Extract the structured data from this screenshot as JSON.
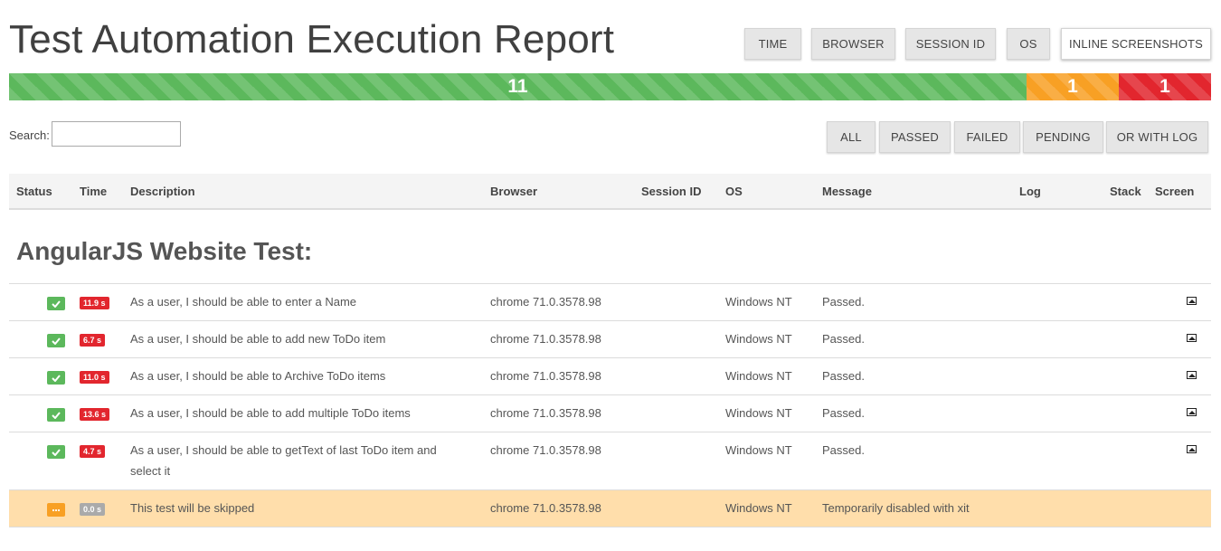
{
  "header": {
    "title": "Test Automation Execution Report",
    "toggles": [
      {
        "label": "TIME"
      },
      {
        "label": "BROWSER"
      },
      {
        "label": "SESSION ID"
      },
      {
        "label": "OS"
      },
      {
        "label": "INLINE SCREENSHOTS"
      }
    ]
  },
  "summary": {
    "passed": "11",
    "pending": "1",
    "failed": "1",
    "colors": {
      "passed": "#5cb85c",
      "pending": "#f8a024",
      "failed": "#e2262e"
    }
  },
  "search": {
    "label": "Search:",
    "value": "",
    "placeholder": ""
  },
  "filters": [
    {
      "label": "ALL"
    },
    {
      "label": "PASSED"
    },
    {
      "label": "FAILED"
    },
    {
      "label": "PENDING"
    },
    {
      "label": "OR WITH LOG"
    }
  ],
  "table": {
    "columns": [
      "Status",
      "Time",
      "Description",
      "Browser",
      "Session ID",
      "OS",
      "Message",
      "Log",
      "Stack",
      "Screen"
    ],
    "suite": "AngularJS Website Test:",
    "rows": [
      {
        "status": "passed",
        "time": "11.9 s",
        "description": "As a user, I should be able to enter a Name",
        "browser": "chrome 71.0.3578.98",
        "session": "",
        "os": "Windows NT",
        "message": "Passed.",
        "screen_icon": "image-icon"
      },
      {
        "status": "passed",
        "time": "6.7 s",
        "description": "As a user, I should be able to add new ToDo item",
        "browser": "chrome 71.0.3578.98",
        "session": "",
        "os": "Windows NT",
        "message": "Passed.",
        "screen_icon": "image-icon"
      },
      {
        "status": "passed",
        "time": "11.0 s",
        "description": "As a user, I should be able to Archive ToDo items",
        "browser": "chrome 71.0.3578.98",
        "session": "",
        "os": "Windows NT",
        "message": "Passed.",
        "screen_icon": "image-icon"
      },
      {
        "status": "passed",
        "time": "13.6 s",
        "description": "As a user, I should be able to add multiple ToDo items",
        "browser": "chrome 71.0.3578.98",
        "session": "",
        "os": "Windows NT",
        "message": "Passed.",
        "screen_icon": "image-icon"
      },
      {
        "status": "passed",
        "time": "4.7 s",
        "description": "As a user, I should be able to getText of last ToDo item and select it",
        "browser": "chrome 71.0.3578.98",
        "session": "",
        "os": "Windows NT",
        "message": "Passed.",
        "screen_icon": "image-icon"
      },
      {
        "status": "pending",
        "time": "0.0 s",
        "description": "This test will be skipped",
        "browser": "chrome 71.0.3578.98",
        "session": "",
        "os": "Windows NT",
        "message": "Temporarily disabled with xit",
        "screen_icon": ""
      }
    ]
  }
}
